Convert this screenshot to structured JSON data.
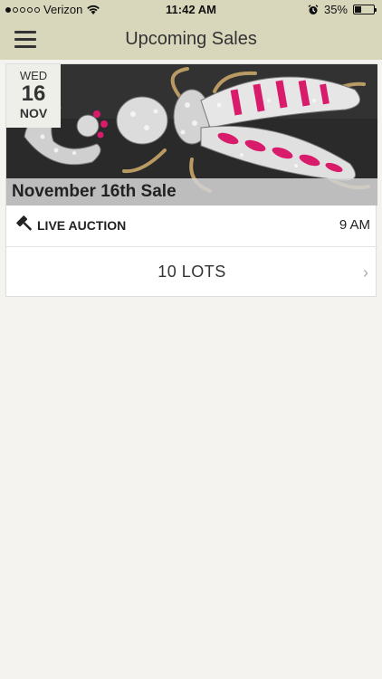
{
  "status_bar": {
    "carrier": "Verizon",
    "time": "11:42 AM",
    "battery": "35%",
    "battery_level": 0.35,
    "icons": [
      "signal-dots-icon",
      "wifi-icon",
      "alarm-icon",
      "battery-icon"
    ]
  },
  "navbar": {
    "title": "Upcoming Sales",
    "menu_icon": "hamburger-menu-icon"
  },
  "sale": {
    "day_of_week": "WED",
    "day": "16",
    "month": "NOV",
    "title": "November 16th Sale",
    "type": "LIVE AUCTION",
    "type_icon": "gavel-icon",
    "time": "9 AM",
    "lots": "10 LOTS",
    "chevron": "›",
    "image": "jeweled-insect-brooch"
  },
  "colors": {
    "header_bg": "#d8d7bc",
    "page_bg": "#f4f3ef",
    "accent_pink": "#d81b6a"
  }
}
